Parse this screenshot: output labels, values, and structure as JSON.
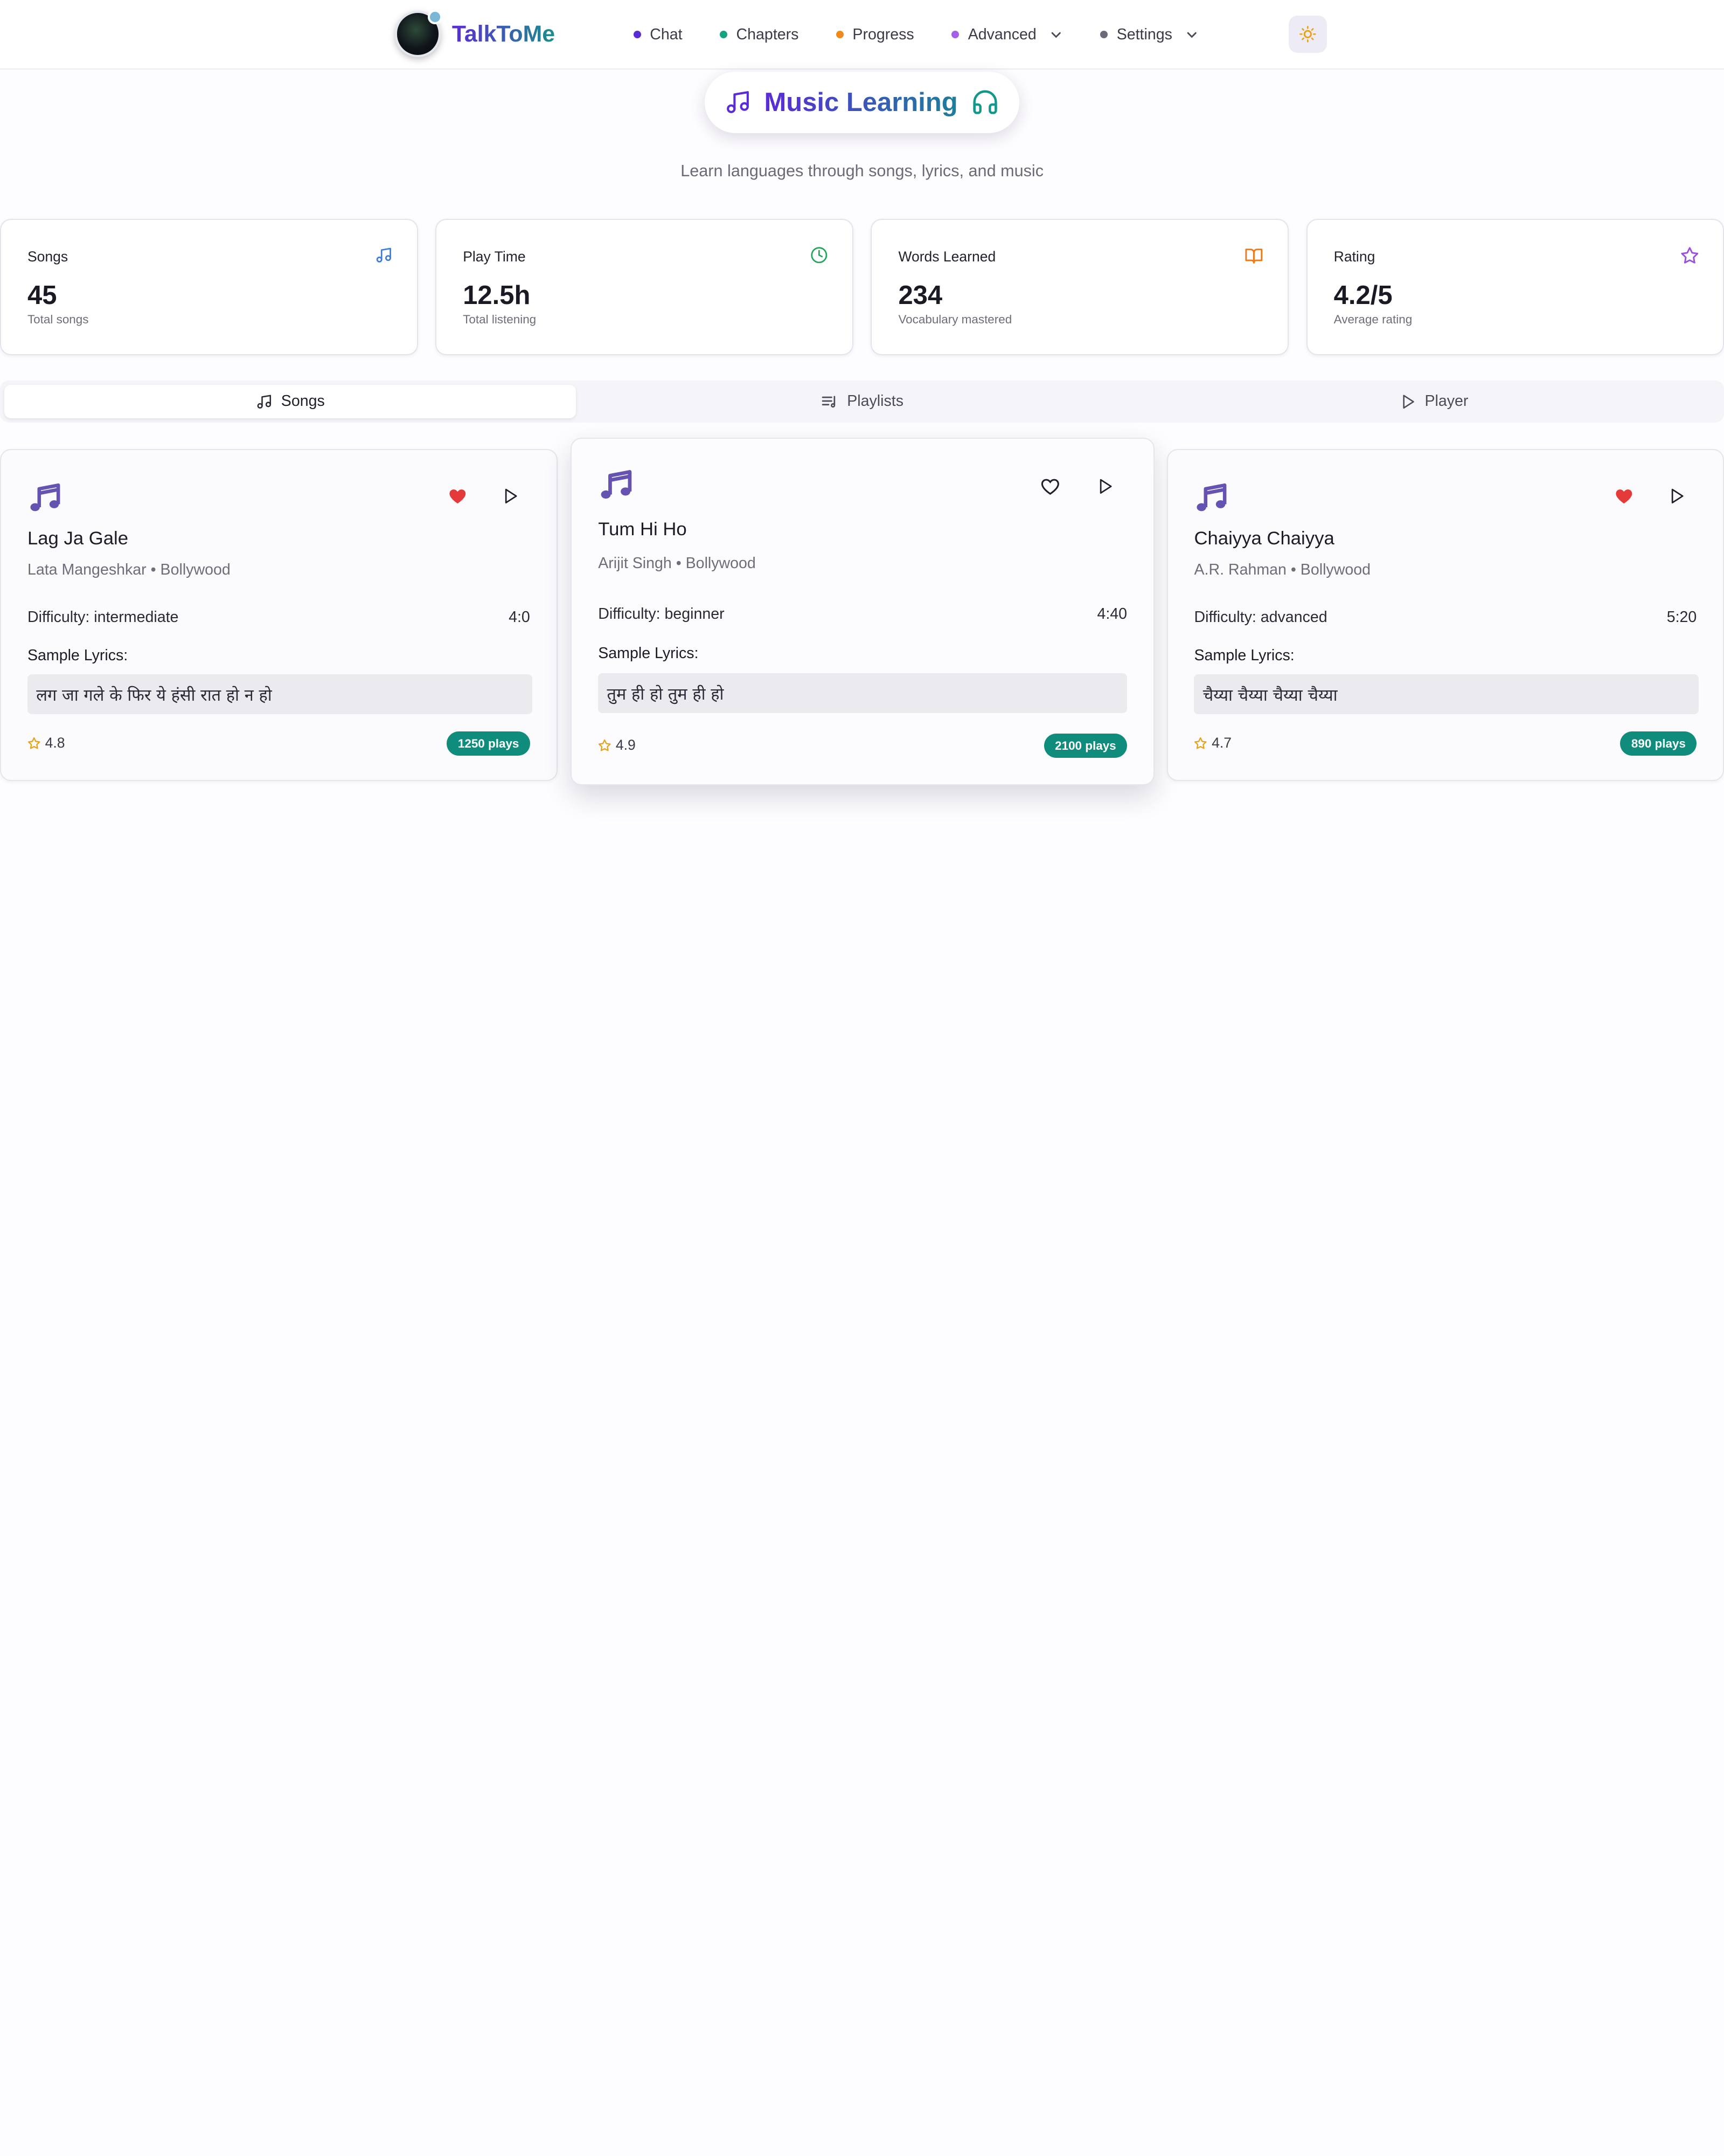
{
  "nav": {
    "brand": "TalkToMe",
    "items": [
      {
        "label": "Chat",
        "color": "#5b2bd6",
        "dropdown": false
      },
      {
        "label": "Chapters",
        "color": "#14a37f",
        "dropdown": false
      },
      {
        "label": "Progress",
        "color": "#f08a1c",
        "dropdown": false
      },
      {
        "label": "Advanced",
        "color": "#a55ee8",
        "dropdown": true
      },
      {
        "label": "Settings",
        "color": "#6b6b78",
        "dropdown": true
      }
    ],
    "theme_icon": "sun-icon"
  },
  "hero": {
    "title": "Music Learning",
    "subtitle": "Learn languages through songs, lyrics, and music"
  },
  "stats": [
    {
      "label": "Songs",
      "value": "45",
      "sub": "Total songs",
      "icon": "music-note-icon",
      "color": "#3b7ddd"
    },
    {
      "label": "Play Time",
      "value": "12.5h",
      "sub": "Total listening",
      "icon": "clock-icon",
      "color": "#22a559"
    },
    {
      "label": "Words Learned",
      "value": "234",
      "sub": "Vocabulary mastered",
      "icon": "book-icon",
      "color": "#ea7a1a"
    },
    {
      "label": "Rating",
      "value": "4.2/5",
      "sub": "Average rating",
      "icon": "star-icon",
      "color": "#9b4de0"
    }
  ],
  "tabs": [
    {
      "label": "Songs",
      "icon": "music-note-icon",
      "active": true
    },
    {
      "label": "Playlists",
      "icon": "playlist-icon",
      "active": false
    },
    {
      "label": "Player",
      "icon": "play-icon",
      "active": false
    }
  ],
  "songs": [
    {
      "title": "Lag Ja Gale",
      "meta": "Lata Mangeshkar • Bollywood",
      "difficulty": "Difficulty: intermediate",
      "duration": "4:0",
      "lyrics_label": "Sample Lyrics:",
      "lyrics": "लग जा गले के फिर ये हंसी रात हो न हो",
      "rating": "4.8",
      "plays": "1250 plays",
      "favorited": true
    },
    {
      "title": "Tum Hi Ho",
      "meta": "Arijit Singh • Bollywood",
      "difficulty": "Difficulty: beginner",
      "duration": "4:40",
      "lyrics_label": "Sample Lyrics:",
      "lyrics": "तुम ही हो तुम ही हो",
      "rating": "4.9",
      "plays": "2100 plays",
      "favorited": false
    },
    {
      "title": "Chaiyya Chaiyya",
      "meta": "A.R. Rahman • Bollywood",
      "difficulty": "Difficulty: advanced",
      "duration": "5:20",
      "lyrics_label": "Sample Lyrics:",
      "lyrics": "चैय्या चैय्या चैय्या चैय्या",
      "rating": "4.7",
      "plays": "890 plays",
      "favorited": true
    }
  ]
}
